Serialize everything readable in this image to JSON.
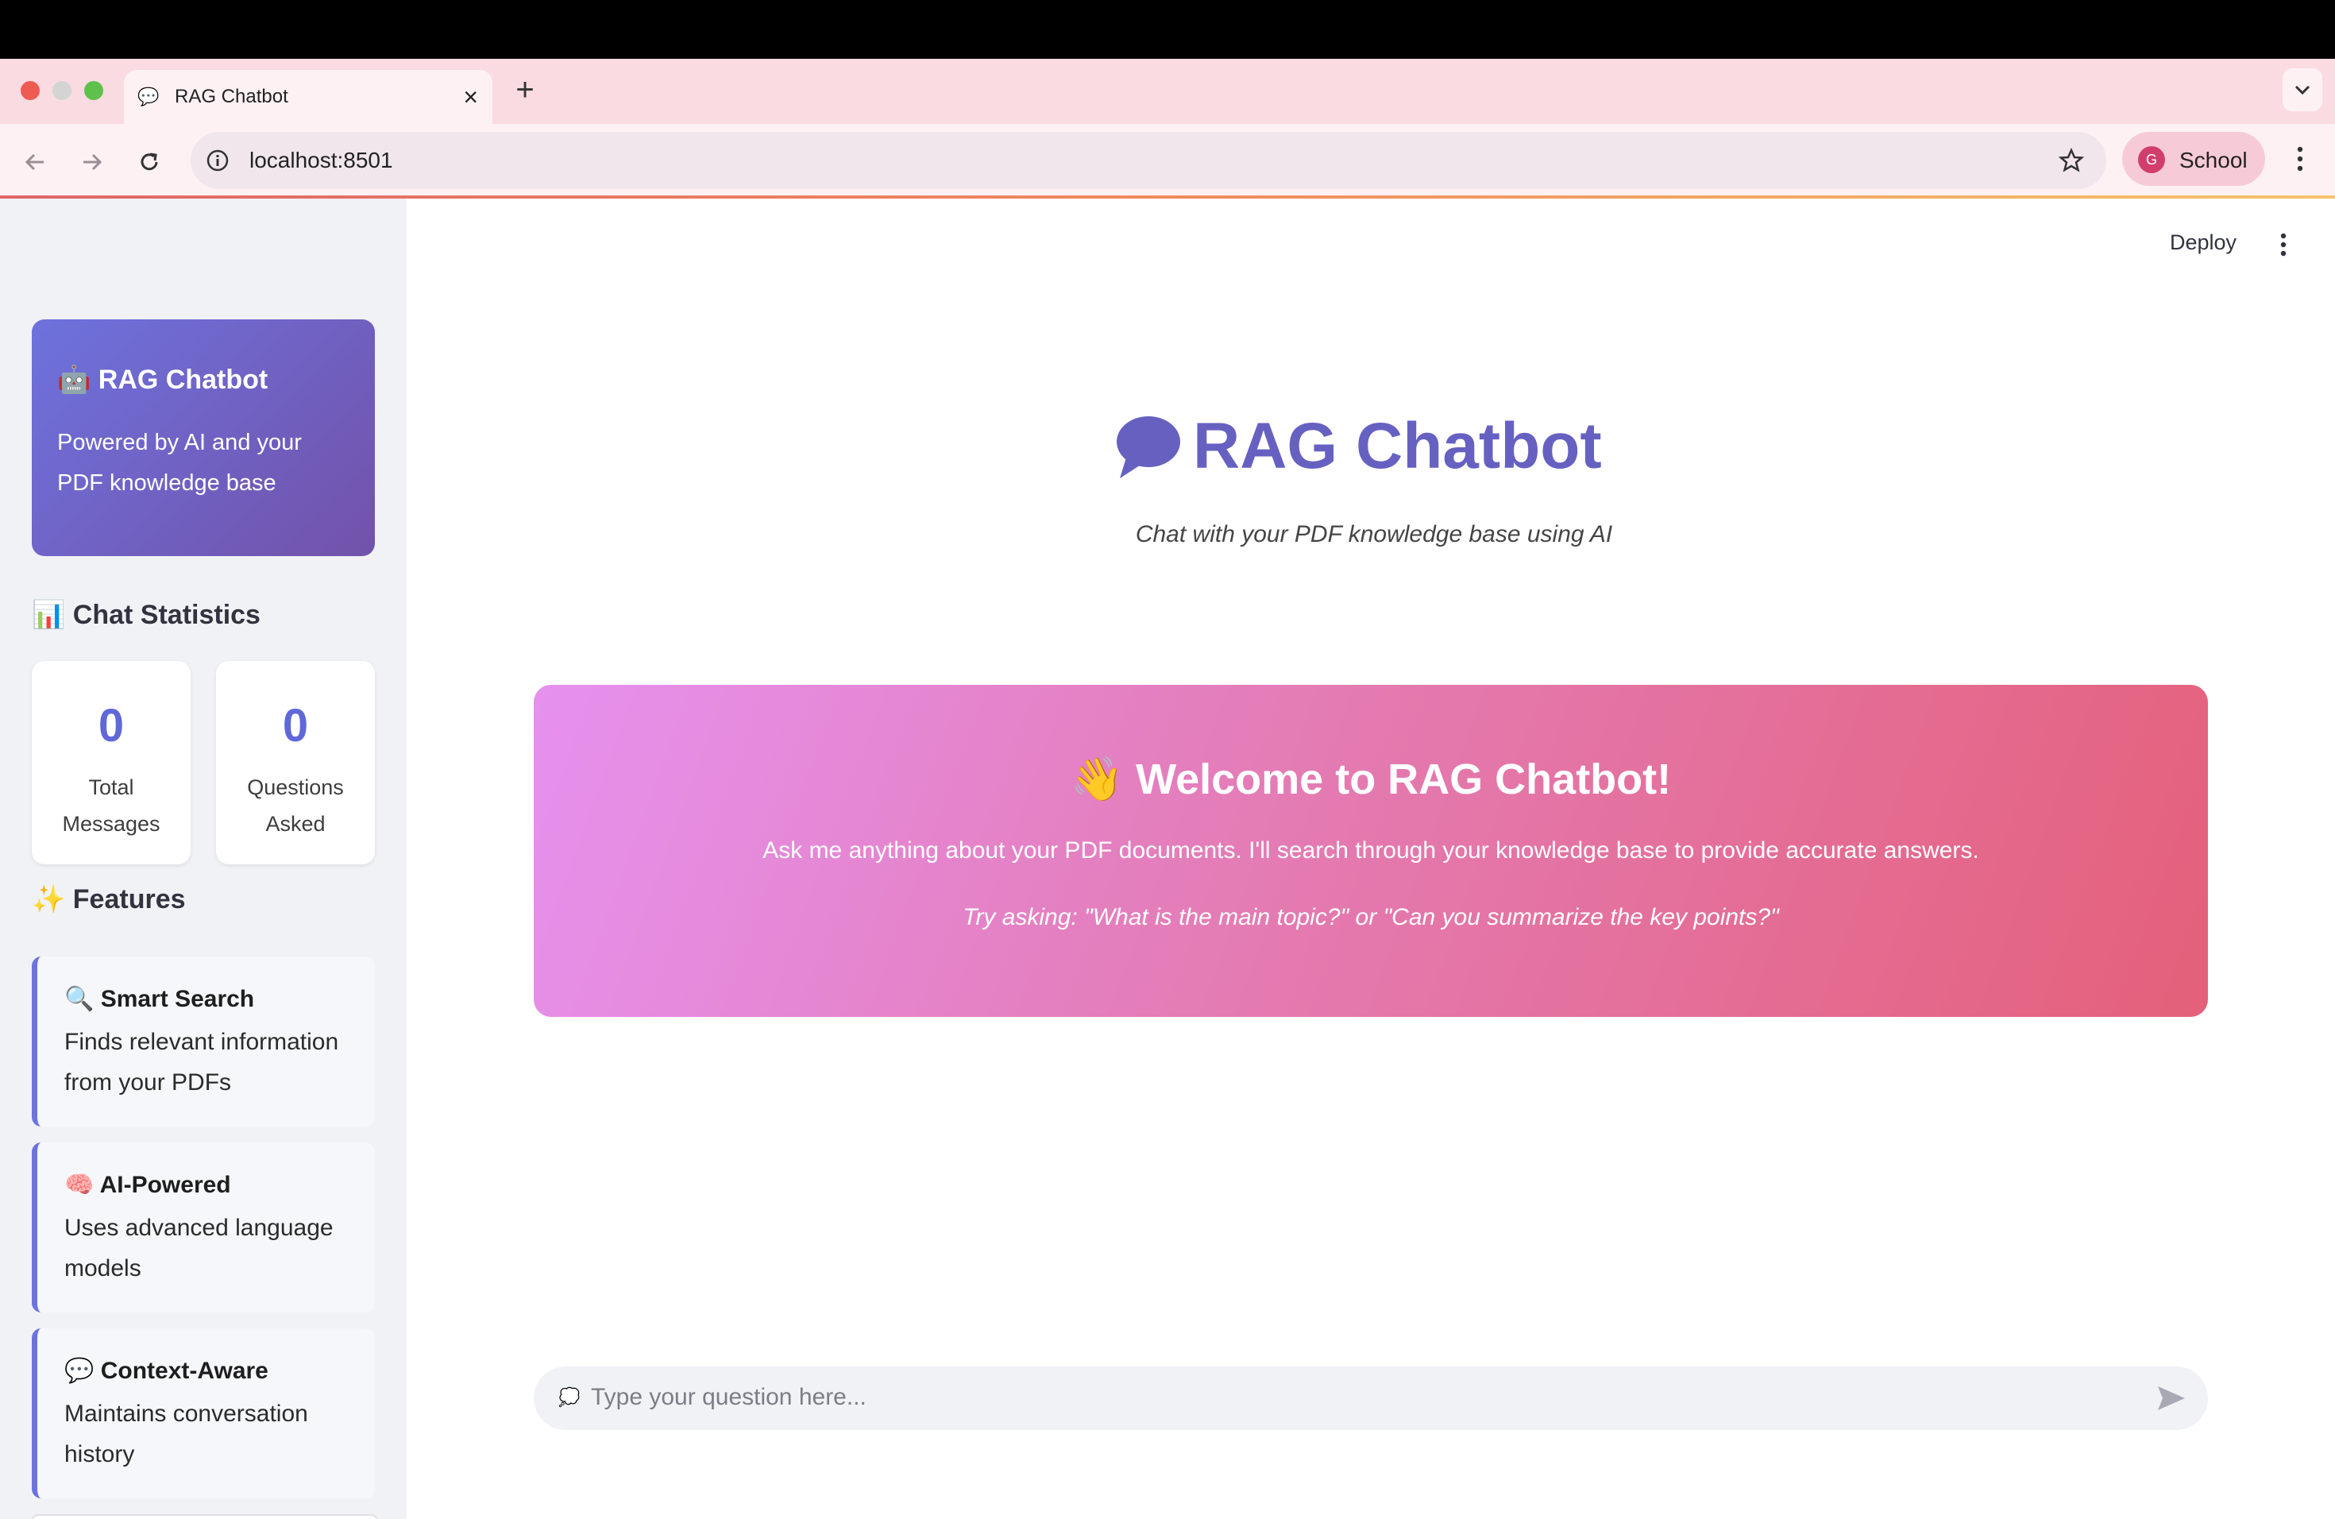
{
  "browser": {
    "tab": {
      "title": "RAG Chatbot",
      "icon": "speech-bubble-icon"
    },
    "address": "localhost:8501",
    "profile": {
      "initial": "G",
      "label": "School"
    },
    "colors": {
      "tabstrip": "#f9dbe1",
      "toolbar": "#fdf1f4",
      "profile_avatar": "#d23e6b"
    }
  },
  "sidebar": {
    "hero": {
      "title": "🤖 RAG Chatbot",
      "subtitle": "Powered by AI and your PDF knowledge base"
    },
    "stats": {
      "heading": "📊 Chat Statistics",
      "items": [
        {
          "value": "0",
          "label": "Total Messages"
        },
        {
          "value": "0",
          "label": "Questions Asked"
        }
      ]
    },
    "features": {
      "heading": "✨ Features",
      "items": [
        {
          "icon": "🔍",
          "title": "Smart Search",
          "desc": "Finds relevant information from your PDFs"
        },
        {
          "icon": "🧠",
          "title": "AI-Powered",
          "desc": "Uses advanced language models"
        },
        {
          "icon": "💬",
          "title": "Context-Aware",
          "desc": "Maintains conversation history"
        }
      ]
    }
  },
  "header": {
    "deploy": "Deploy"
  },
  "main": {
    "title": "RAG Chatbot",
    "subtitle": "Chat with your PDF knowledge base using AI",
    "welcome": {
      "title": "👋 Welcome to RAG Chatbot!",
      "text": "Ask me anything about your PDF documents. I'll search through your knowledge base to provide accurate answers.",
      "hint": "Try asking: \"What is the main topic?\" or \"Can you summarize the key points?\""
    },
    "chat_input": {
      "placeholder": "Type your question here...",
      "icon": "💭"
    },
    "colors": {
      "accent": "#6661c1",
      "stat_value": "#6068d8",
      "welcome_start": "#e691ef",
      "welcome_end": "#e4607a"
    }
  }
}
